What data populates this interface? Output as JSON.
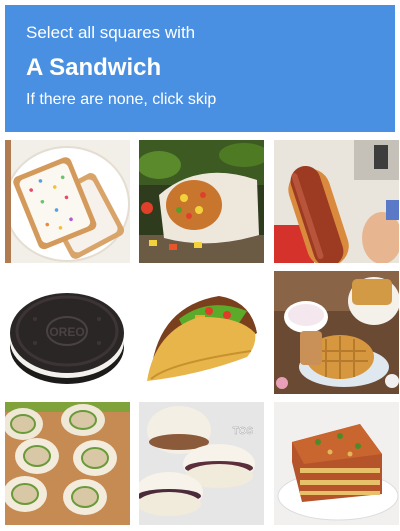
{
  "header": {
    "instruction": "Select all squares with",
    "target": "A Sandwich",
    "skip_hint": "If there are none, click skip",
    "background_color": "#4a90e2"
  },
  "tiles": [
    {
      "label": "pop-tarts",
      "selected": false
    },
    {
      "label": "burrito",
      "selected": false
    },
    {
      "label": "hot-dog",
      "selected": false
    },
    {
      "label": "oreo-cookie",
      "selected": false
    },
    {
      "label": "taco",
      "selected": false
    },
    {
      "label": "waffles",
      "selected": false
    },
    {
      "label": "pinwheel-rolls",
      "selected": false
    },
    {
      "label": "crustless-sandwich",
      "selected": false,
      "watermark": "TOS"
    },
    {
      "label": "lasagna",
      "selected": false
    }
  ]
}
